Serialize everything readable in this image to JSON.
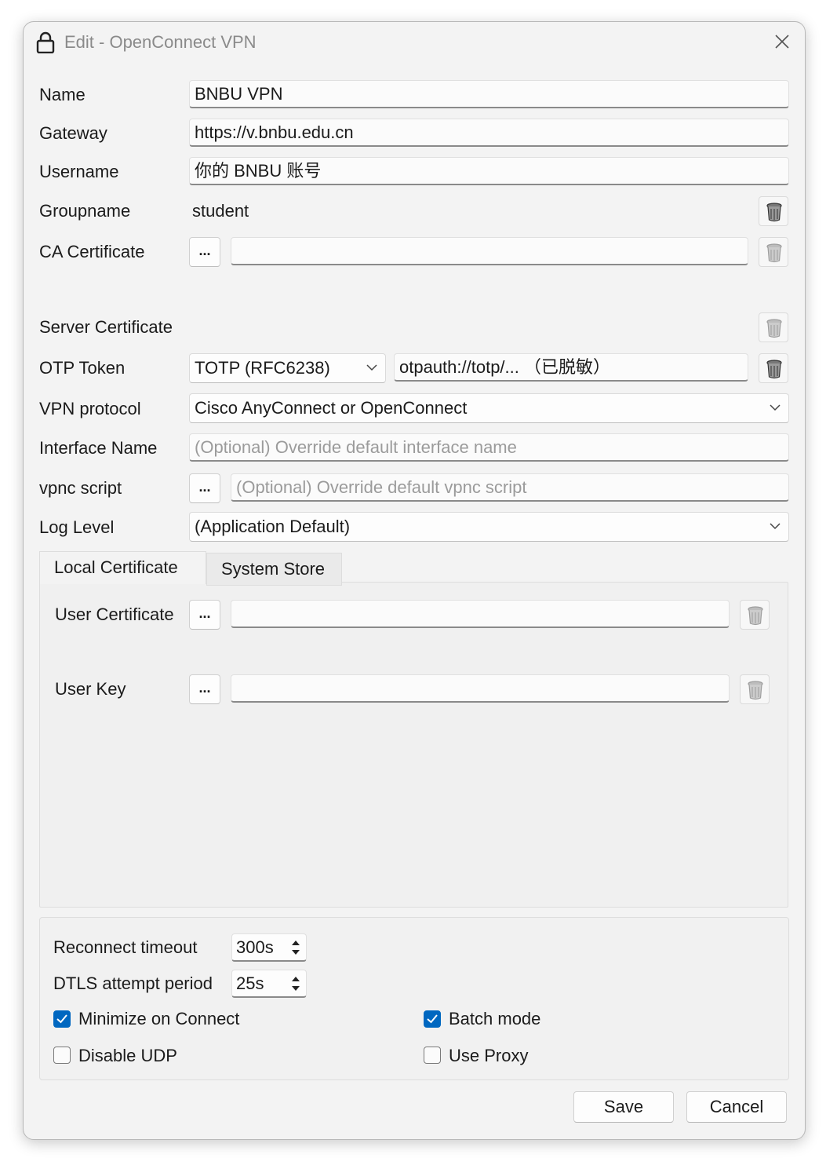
{
  "window": {
    "title": "Edit - OpenConnect VPN"
  },
  "form": {
    "name_label": "Name",
    "name_value": "BNBU VPN",
    "gateway_label": "Gateway",
    "gateway_value": "https://v.bnbu.edu.cn",
    "username_label": "Username",
    "username_value": "你的 BNBU 账号",
    "groupname_label": "Groupname",
    "groupname_value": "student",
    "ca_cert_label": "CA Certificate",
    "ca_cert_button": "...",
    "ca_cert_value": "",
    "server_cert_label": "Server Certificate",
    "otp_label": "OTP Token",
    "otp_type": "TOTP (RFC6238)",
    "otp_value": "otpauth://totp/...  （已脱敏）",
    "vpn_protocol_label": "VPN protocol",
    "vpn_protocol_value": "Cisco AnyConnect or OpenConnect",
    "interface_label": "Interface Name",
    "interface_placeholder": "(Optional) Override default interface name",
    "vpnc_label": "vpnc script",
    "vpnc_button": "...",
    "vpnc_placeholder": "(Optional) Override default vpnc script",
    "log_level_label": "Log Level",
    "log_level_value": "(Application Default)"
  },
  "tabs": {
    "local": "Local Certificate",
    "system": "System Store",
    "user_cert_label": "User Certificate",
    "user_cert_button": "...",
    "user_key_label": "User Key",
    "user_key_button": "..."
  },
  "options": {
    "reconnect_label": "Reconnect timeout",
    "reconnect_value": "300s",
    "dtls_label": "DTLS attempt period",
    "dtls_value": "25s",
    "minimize_label": "Minimize on Connect",
    "minimize_checked": true,
    "batch_label": "Batch mode",
    "batch_checked": true,
    "disable_udp_label": "Disable UDP",
    "disable_udp_checked": false,
    "use_proxy_label": "Use Proxy",
    "use_proxy_checked": false
  },
  "buttons": {
    "save": "Save",
    "cancel": "Cancel"
  },
  "colors": {
    "accent": "#0067c0",
    "window_bg": "#f3f3f3"
  }
}
